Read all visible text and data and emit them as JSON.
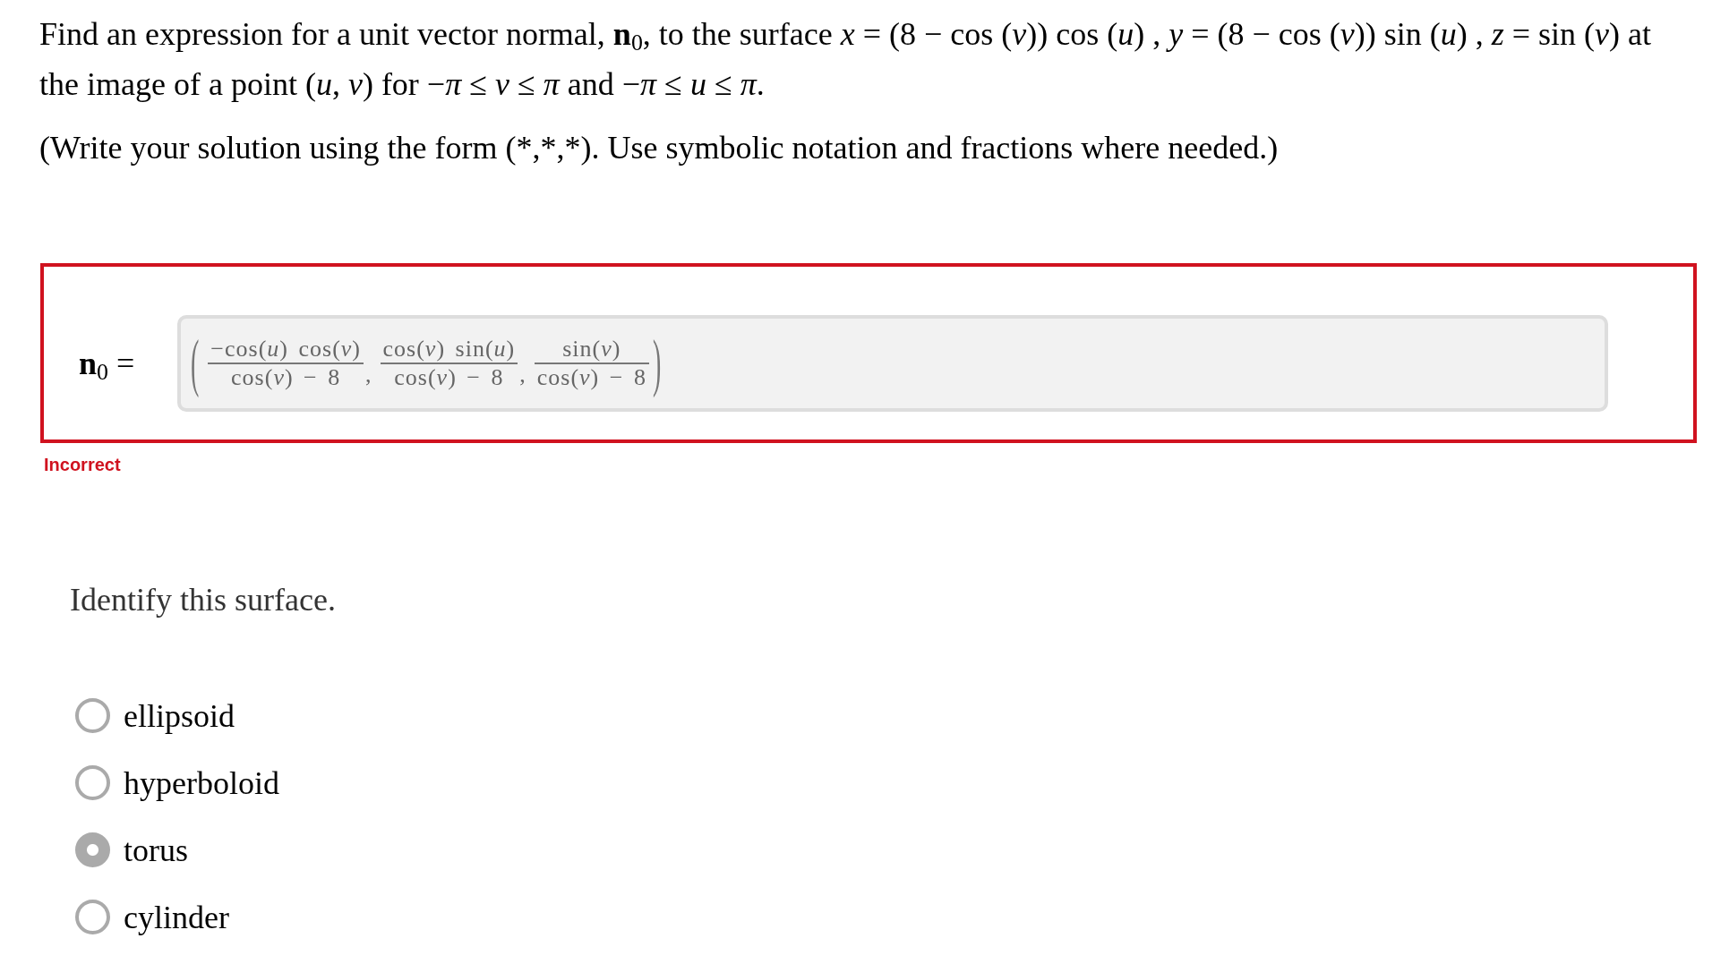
{
  "question": {
    "prompt": "Find an expression for a unit vector normal, **n**$_{0}$, to the surface *x* = (8 − cos (*v*)) cos (*u*) , *y* = (8 − cos (*v*)) sin (*u*) , *z* = sin (*v*) at the image of a point (*u*, *v*) for −*π* ≤ *v* ≤ *π* and −*π* ≤ *u* ≤ *π*.",
    "instructions": "(Write your solution using the form (*,*,*). Use symbolic notation and fractions where needed.)"
  },
  "answer": {
    "label": "**n**$_{0}$ =",
    "value": {
      "open": "(",
      "components": [
        {
          "numerator": "−cos(*u*) cos(*v*)",
          "denominator": "cos(*v*) − 8",
          "separator": ","
        },
        {
          "numerator": "cos(*v*) sin(*u*)",
          "denominator": "cos(*v*) − 8",
          "separator": ","
        },
        {
          "numerator": "sin(*v*)",
          "denominator": "cos(*v*) − 8"
        }
      ],
      "close": ")"
    },
    "feedback": {
      "kind": "incorrect",
      "text": "Incorrect"
    }
  },
  "surface_question": {
    "prompt": "Identify this surface.",
    "options": [
      {
        "label": "ellipsoid",
        "selected": false
      },
      {
        "label": "hyperboloid",
        "selected": false
      },
      {
        "label": "torus",
        "selected": true
      },
      {
        "label": "cylinder",
        "selected": false
      }
    ]
  }
}
